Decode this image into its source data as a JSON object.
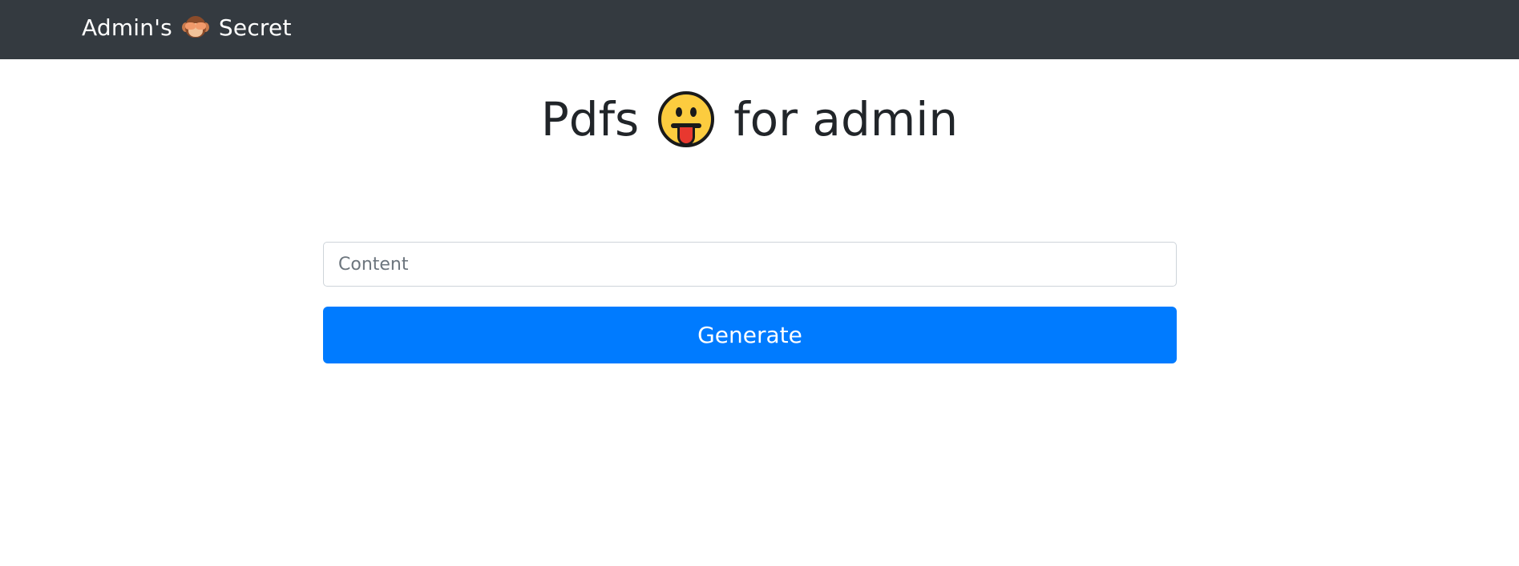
{
  "navbar": {
    "brand_text_before": "Admin's",
    "brand_icon": "see-no-evil-monkey-icon",
    "brand_text_after": "Secret"
  },
  "main": {
    "title_before": "Pdfs",
    "title_icon": "tongue-out-face-icon",
    "title_after": "for admin"
  },
  "form": {
    "content_placeholder": "Content",
    "content_value": "",
    "generate_label": "Generate"
  },
  "colors": {
    "navbar_bg": "#343a40",
    "primary": "#007bff",
    "text": "#212529"
  }
}
